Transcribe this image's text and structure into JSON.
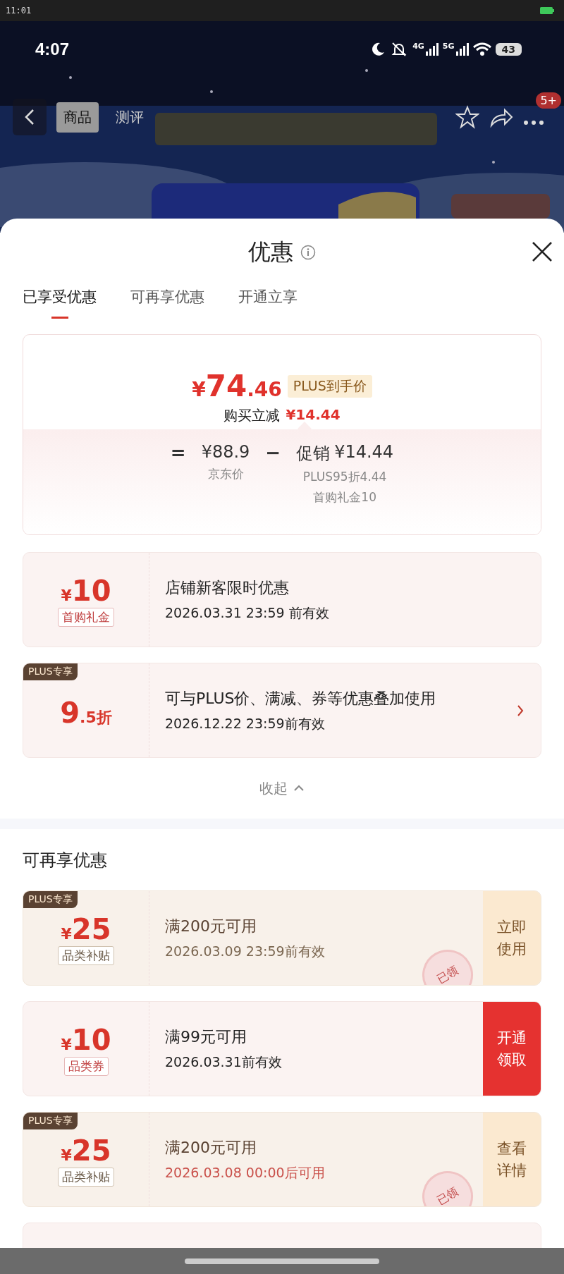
{
  "system_bar": {
    "time": "11:01"
  },
  "product_header": {
    "status": {
      "time": "4:07",
      "network_1": "4G",
      "network_2": "5G",
      "battery": "43"
    },
    "tabs": [
      {
        "label": "商品",
        "selected": true
      },
      {
        "label": "测评",
        "selected": false
      }
    ],
    "badge": "5+"
  },
  "sheet": {
    "title": "优惠",
    "tabs": [
      {
        "label": "已享受优惠",
        "selected": true
      },
      {
        "label": "可再享优惠",
        "selected": false
      },
      {
        "label": "开通立享",
        "selected": false
      }
    ],
    "price_card": {
      "currency": "¥",
      "price_int": "74",
      "price_dec": ".46",
      "price_badge": "PLUS到手价",
      "saving_label": "购买立减",
      "saving_value": "¥14.44",
      "equals": "=",
      "base_price": "¥88.9",
      "base_label": "京东价",
      "minus": "−",
      "promo_label": "促销",
      "promo_value": "¥14.44",
      "promo_details": [
        "PLUS95折4.44",
        "首购礼金10"
      ]
    },
    "applied_coupons": [
      {
        "kind": "normal",
        "currency": "¥",
        "amount": "10",
        "tag": "首购礼金",
        "title": "店铺新客限时优惠",
        "validity": "2026.03.31 23:59 前有效",
        "has_arrow": false
      },
      {
        "kind": "normal",
        "plus_badge": "PLUS专享",
        "amount": "9",
        "amount_suffix": ".5折",
        "title": "可与PLUS价、满减、券等优惠叠加使用",
        "validity": "2026.12.22 23:59前有效",
        "has_arrow": true
      }
    ],
    "collapse": "收起",
    "more_heading": "可再享优惠",
    "more_coupons": [
      {
        "kind": "plus",
        "plus_badge": "PLUS专享",
        "currency": "¥",
        "amount": "25",
        "tag": "品类补贴",
        "title": "满200元可用",
        "validity": "2026.03.09 23:59前有效",
        "validity_highlight": false,
        "stamp": "已领",
        "action": {
          "kind": "soft",
          "label": "立即使用"
        }
      },
      {
        "kind": "normal",
        "currency": "¥",
        "amount": "10",
        "tag": "品类券",
        "title": "满99元可用",
        "validity": "2026.03.31前有效",
        "validity_highlight": false,
        "action": {
          "kind": "primary",
          "label": "开通领取"
        }
      },
      {
        "kind": "plus",
        "plus_badge": "PLUS专享",
        "currency": "¥",
        "amount": "25",
        "tag": "品类补贴",
        "title": "满200元可用",
        "validity": "2026.03.08 00:00后可用",
        "validity_highlight": true,
        "stamp": "已领",
        "action": {
          "kind": "soft",
          "label": "查看详情"
        }
      }
    ]
  }
}
